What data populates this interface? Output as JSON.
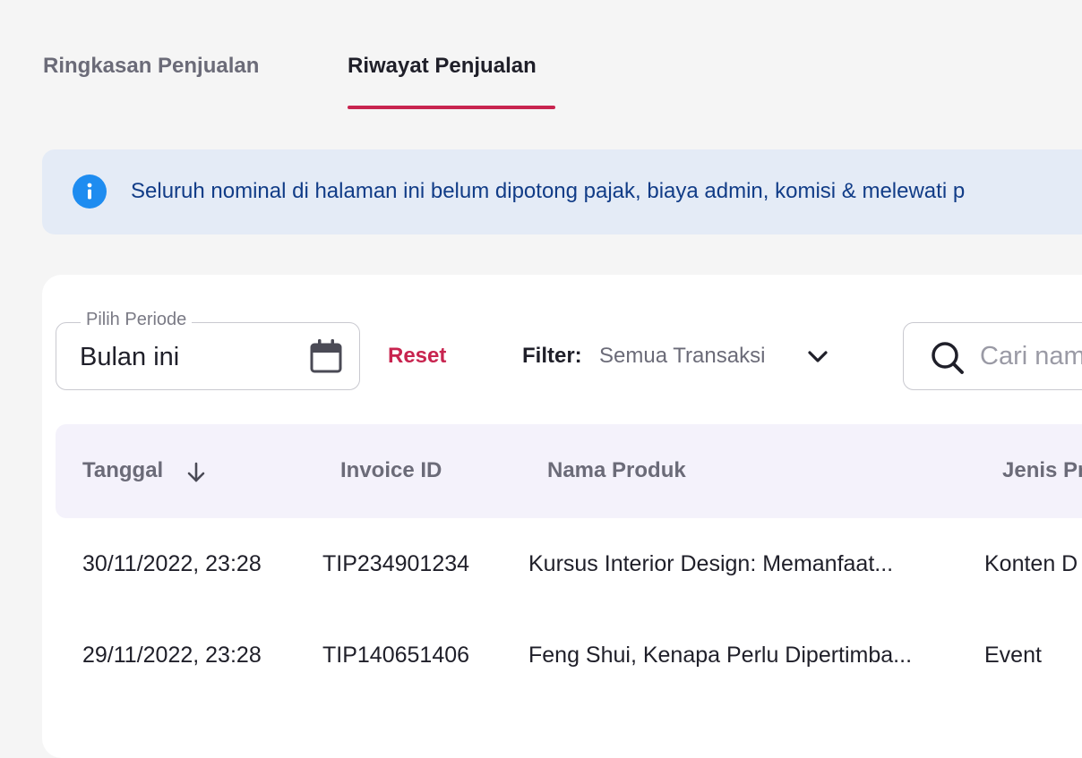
{
  "tabs": [
    {
      "label": "Ringkasan Penjualan",
      "active": false
    },
    {
      "label": "Riwayat Penjualan",
      "active": true
    }
  ],
  "colors": {
    "accent": "#c8244f",
    "info_bg": "#e4ebf6",
    "info_text": "#113c87",
    "info_icon": "#1e8cf0"
  },
  "info_banner": {
    "icon": "info-icon",
    "text": "Seluruh nominal di halaman ini belum dipotong pajak, biaya admin, komisi & melewati p"
  },
  "period": {
    "label": "Pilih Periode",
    "value": "Bulan ini",
    "icon": "calendar-icon"
  },
  "reset_label": "Reset",
  "filter": {
    "label": "Filter:",
    "value": "Semua Transaksi",
    "icon": "chevron-down-icon"
  },
  "search": {
    "icon": "search-icon",
    "placeholder": "Cari nam"
  },
  "table": {
    "headers": {
      "date": "Tanggal",
      "invoice": "Invoice ID",
      "product": "Nama Produk",
      "type": "Jenis Pr"
    },
    "sort_icon": "arrow-down-icon",
    "rows": [
      {
        "date": "30/11/2022, 23:28",
        "invoice": "TIP234901234",
        "product": "Kursus Interior Design: Memanfaat...",
        "type": "Konten D"
      },
      {
        "date": "29/11/2022, 23:28",
        "invoice": "TIP140651406",
        "product": "Feng Shui, Kenapa Perlu Dipertimba...",
        "type": "Event"
      }
    ]
  }
}
